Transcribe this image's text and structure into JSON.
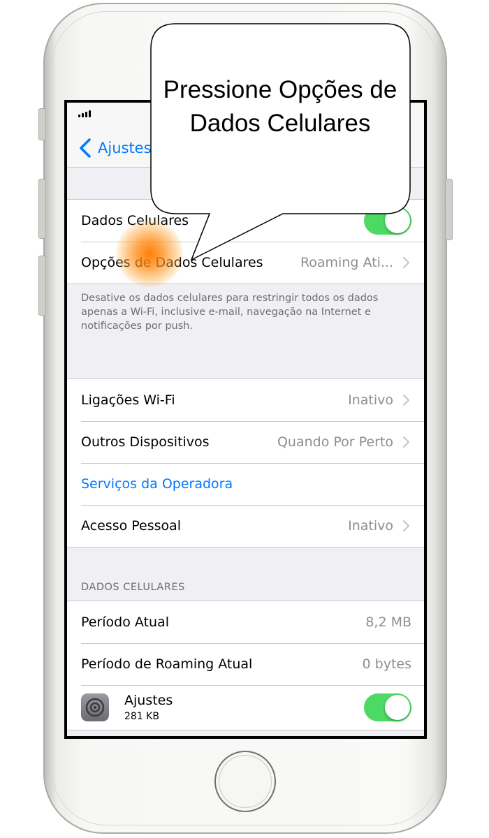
{
  "callout": {
    "text": "Pressione Opções de Dados Celulares"
  },
  "nav": {
    "back_label": "Ajustes"
  },
  "cellular_group": {
    "cellular_data_label": "Dados Celulares",
    "cellular_data_enabled": true,
    "options_label": "Opções de Dados Celulares",
    "options_value": "Roaming Ati..."
  },
  "cellular_footer": "Desative os dados celulares para restringir todos os dados apenas a Wi-Fi, inclusive e-mail, navegação na Internet e notificações por push.",
  "services_group": [
    {
      "label": "Ligações Wi-Fi",
      "value": "Inativo"
    },
    {
      "label": "Outros Dispositivos",
      "value": "Quando Por Perto"
    },
    {
      "label": "Serviços da Operadora",
      "value": ""
    },
    {
      "label": "Acesso Pessoal",
      "value": "Inativo"
    }
  ],
  "data_section": {
    "header": "DADOS CELULARES",
    "current_period_label": "Período Atual",
    "current_period_value": "8,2 MB",
    "roaming_period_label": "Período de Roaming Atual",
    "roaming_period_value": "0 bytes",
    "app_name": "Ajustes",
    "app_size": "281 KB",
    "app_enabled": true
  },
  "colors": {
    "accent": "#007aff",
    "toggle_on": "#4cd964",
    "tap_indicator": "#ff8000"
  }
}
